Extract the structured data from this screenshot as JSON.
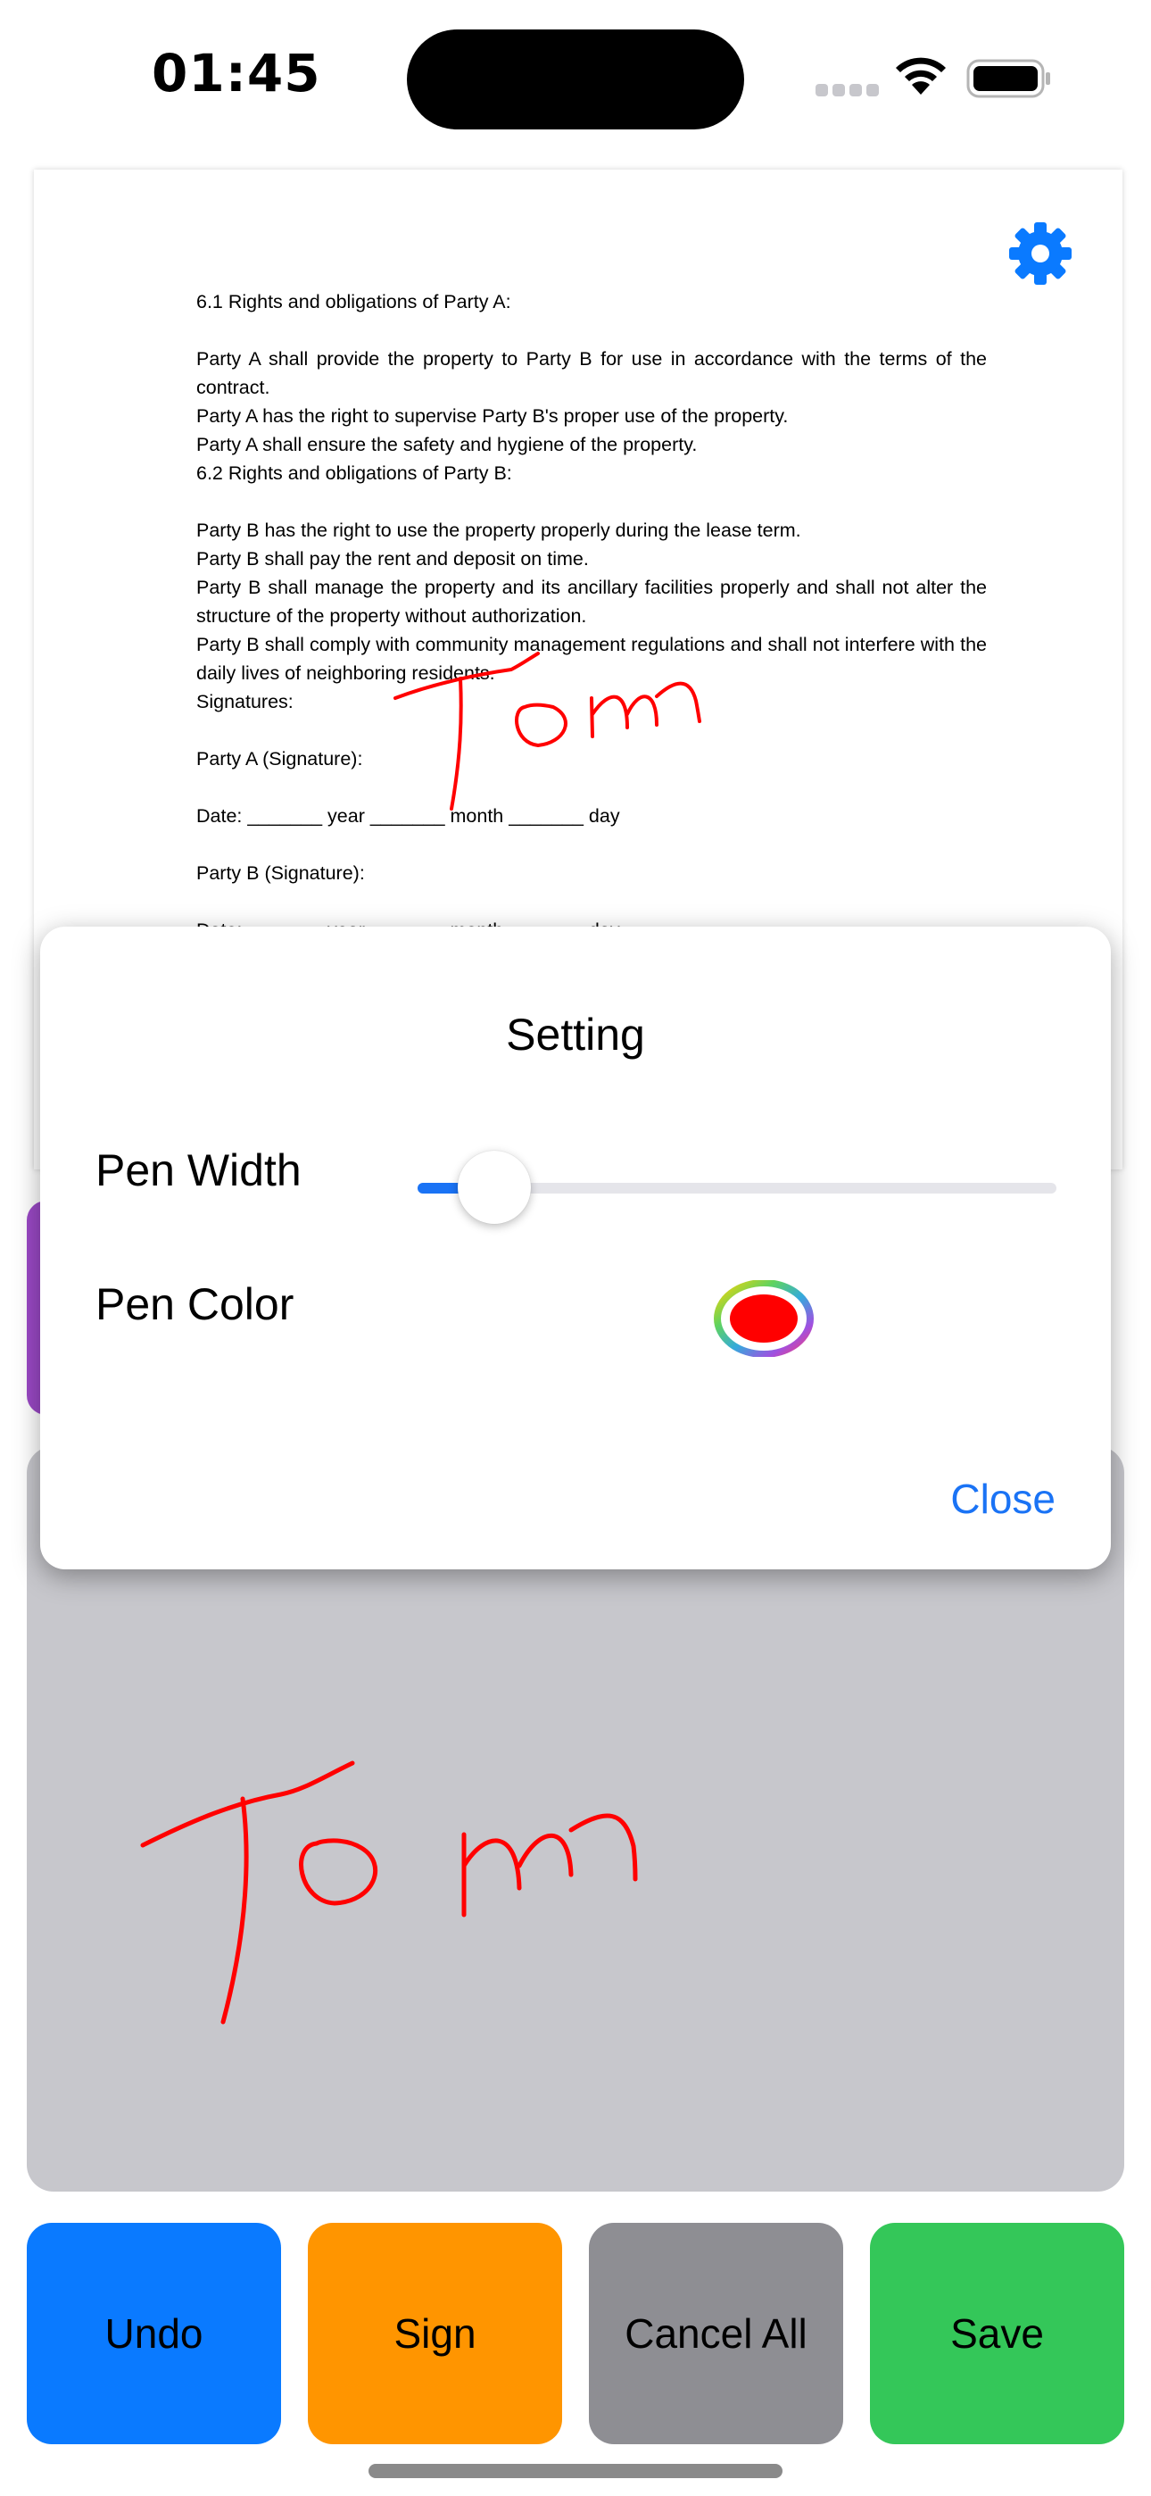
{
  "status_bar": {
    "time": "01:45"
  },
  "document": {
    "lines": [
      "6.1 Rights and obligations of Party A:",
      "",
      "Party A shall provide the property to Party B for use in accordance with the terms of the contract.",
      "Party A has the right to supervise Party B's proper use of the property.",
      "Party A shall ensure the safety and hygiene of the property.",
      "6.2 Rights and obligations of Party B:",
      "",
      "Party B has the right to use the property properly during the lease term.",
      "Party B shall pay the rent and deposit on time.",
      "Party B shall manage the property and its ancillary facilities properly and shall not alter the structure of the property without authorization.",
      "Party B shall comply with community management regulations and shall not interfere with the daily lives of neighboring residents.",
      "Signatures:",
      "",
      "Party A (Signature):",
      "",
      "Date: _______ year _______ month _______ day",
      "",
      "Party B (Signature):",
      "",
      "Date: _______ year _______ month _______ day"
    ],
    "signature_text": "Tom"
  },
  "settings_dialog": {
    "title": "Setting",
    "pen_width_label": "Pen Width",
    "pen_width_value": 0.12,
    "pen_color_label": "Pen Color",
    "pen_color": "#ff0000",
    "close_label": "Close"
  },
  "signature_pad": {
    "signature_text": "Tom",
    "stroke_color": "#ff0000"
  },
  "buttons": {
    "undo": "Undo",
    "sign": "Sign",
    "cancel_all": "Cancel All",
    "save": "Save"
  },
  "icons": {
    "settings": "gear-icon",
    "wifi": "wifi-icon",
    "battery": "battery-icon",
    "signal": "cellular-signal-icon"
  }
}
